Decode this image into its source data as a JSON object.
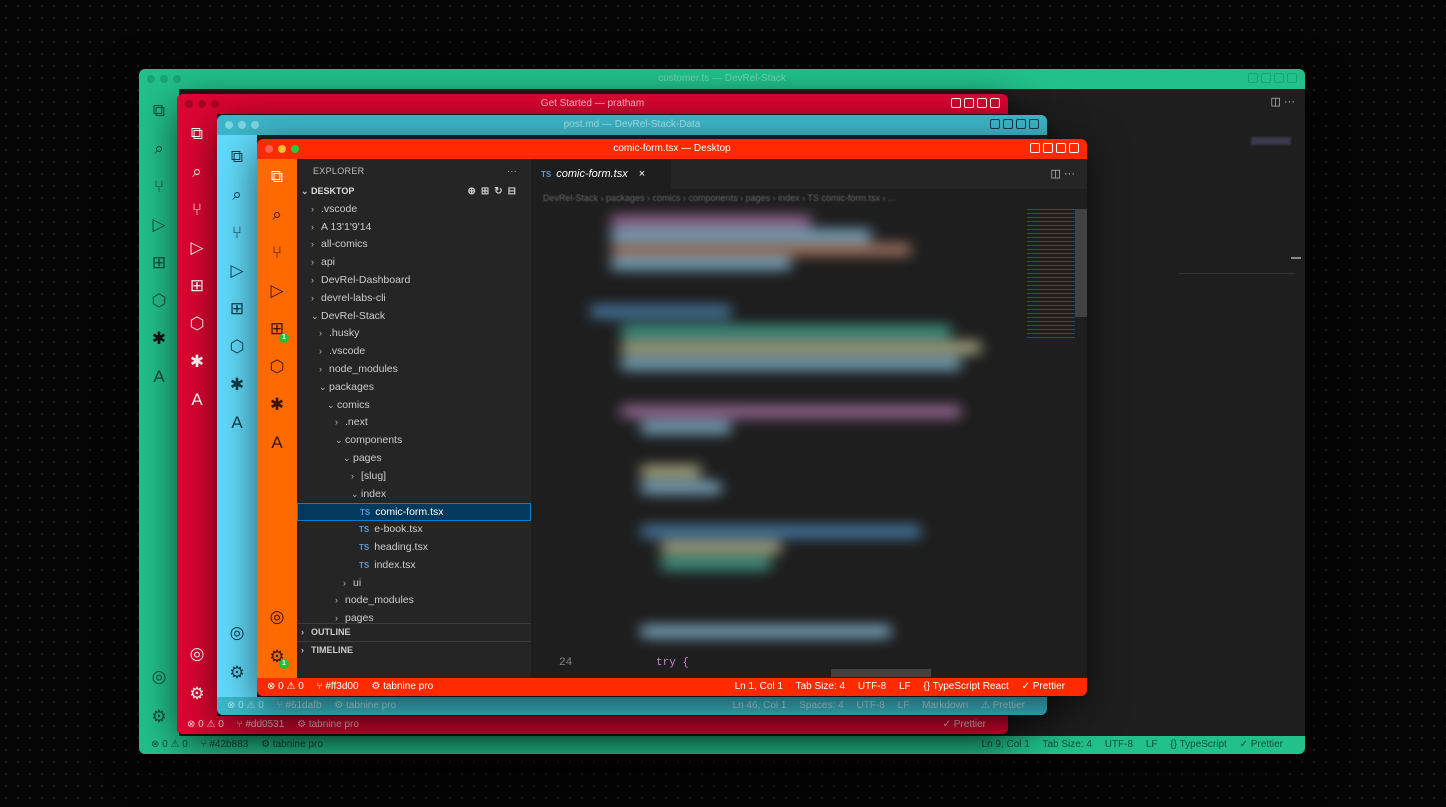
{
  "windows": {
    "green": {
      "title": "customer.ts — DevRel-Stack",
      "accent": "#22c08a",
      "status": {
        "errors": "⊗ 0 ⚠ 0",
        "branch": "⑂ #42b883",
        "tabnine": "⚙ tabnine pro",
        "position": "Ln 9, Col 1",
        "tab": "Tab Size: 4",
        "enc": "UTF-8",
        "eol": "LF",
        "lang": "{} TypeScript",
        "prettier": "✓ Prettier"
      }
    },
    "crimson": {
      "title": "Get Started — pratham",
      "accent": "#dd0531",
      "status": {
        "errors": "⊗ 0 ⚠ 0",
        "branch": "⑂ #dd0531",
        "tabnine": "⚙ tabnine pro",
        "prettier": "✓ Prettier"
      }
    },
    "cyan": {
      "title": "post.md — DevRel-Stack-Data",
      "accent": "#61dafb",
      "status": {
        "errors": "⊗ 0 ⚠ 0",
        "branch": "⑂ #61dafb",
        "tabnine": "⚙ tabnine pro",
        "position": "Ln 46, Col 1",
        "spaces": "Spaces: 4",
        "enc": "UTF-8",
        "eol": "LF",
        "lang": "Markdown",
        "prettier": "⚠ Prettier"
      }
    },
    "front": {
      "title": "comic-form.tsx — Desktop",
      "accent": "#ff3d00",
      "explorer_label": "EXPLORER",
      "explorer_more": "···",
      "root_label": "DESKTOP",
      "tab_label": "comic-form.tsx",
      "tab_close": "×",
      "breadcrumb": "DevRel-Stack › packages › comics › components › pages › index › TS comic-form.tsx › ...",
      "line_number": "24",
      "code_line": "try {",
      "outline_label": "OUTLINE",
      "timeline_label": "TIMELINE",
      "status": {
        "errors": "⊗ 0 ⚠ 0",
        "branch": "⑂ #ff3d00",
        "tabnine": "⚙ tabnine pro",
        "position": "Ln 1, Col 1",
        "tab": "Tab Size: 4",
        "enc": "UTF-8",
        "eol": "LF",
        "lang": "{} TypeScript React",
        "prettier": "✓ Prettier"
      }
    }
  },
  "tree": [
    {
      "label": ".vscode",
      "indent": 0,
      "kind": "folder",
      "open": false
    },
    {
      "label": "A 13'1'9'14",
      "indent": 0,
      "kind": "folder",
      "open": false
    },
    {
      "label": "all-comics",
      "indent": 0,
      "kind": "folder",
      "open": false
    },
    {
      "label": "api",
      "indent": 0,
      "kind": "folder",
      "open": false
    },
    {
      "label": "DevRel-Dashboard",
      "indent": 0,
      "kind": "folder",
      "open": false
    },
    {
      "label": "devrel-labs-cli",
      "indent": 0,
      "kind": "folder",
      "open": false
    },
    {
      "label": "DevRel-Stack",
      "indent": 0,
      "kind": "folder",
      "open": true
    },
    {
      "label": ".husky",
      "indent": 1,
      "kind": "folder",
      "open": false
    },
    {
      "label": ".vscode",
      "indent": 1,
      "kind": "folder",
      "open": false
    },
    {
      "label": "node_modules",
      "indent": 1,
      "kind": "folder",
      "open": false
    },
    {
      "label": "packages",
      "indent": 1,
      "kind": "folder",
      "open": true
    },
    {
      "label": "comics",
      "indent": 2,
      "kind": "folder",
      "open": true
    },
    {
      "label": ".next",
      "indent": 3,
      "kind": "folder",
      "open": false
    },
    {
      "label": "components",
      "indent": 3,
      "kind": "folder",
      "open": true
    },
    {
      "label": "pages",
      "indent": 4,
      "kind": "folder",
      "open": true
    },
    {
      "label": "[slug]",
      "indent": 5,
      "kind": "folder",
      "open": false
    },
    {
      "label": "index",
      "indent": 5,
      "kind": "folder",
      "open": true
    },
    {
      "label": "comic-form.tsx",
      "indent": 6,
      "kind": "ts",
      "selected": true
    },
    {
      "label": "e-book.tsx",
      "indent": 6,
      "kind": "ts"
    },
    {
      "label": "heading.tsx",
      "indent": 6,
      "kind": "ts"
    },
    {
      "label": "index.tsx",
      "indent": 6,
      "kind": "ts"
    },
    {
      "label": "ui",
      "indent": 4,
      "kind": "folder",
      "open": false
    },
    {
      "label": "node_modules",
      "indent": 3,
      "kind": "folder",
      "open": false
    },
    {
      "label": "pages",
      "indent": 3,
      "kind": "folder",
      "open": false
    }
  ],
  "icons": {
    "ts_prefix": "TS",
    "chevron_closed": "›",
    "chevron_open": "⌄"
  },
  "badges": {
    "extensions": "1",
    "settings": "1"
  }
}
